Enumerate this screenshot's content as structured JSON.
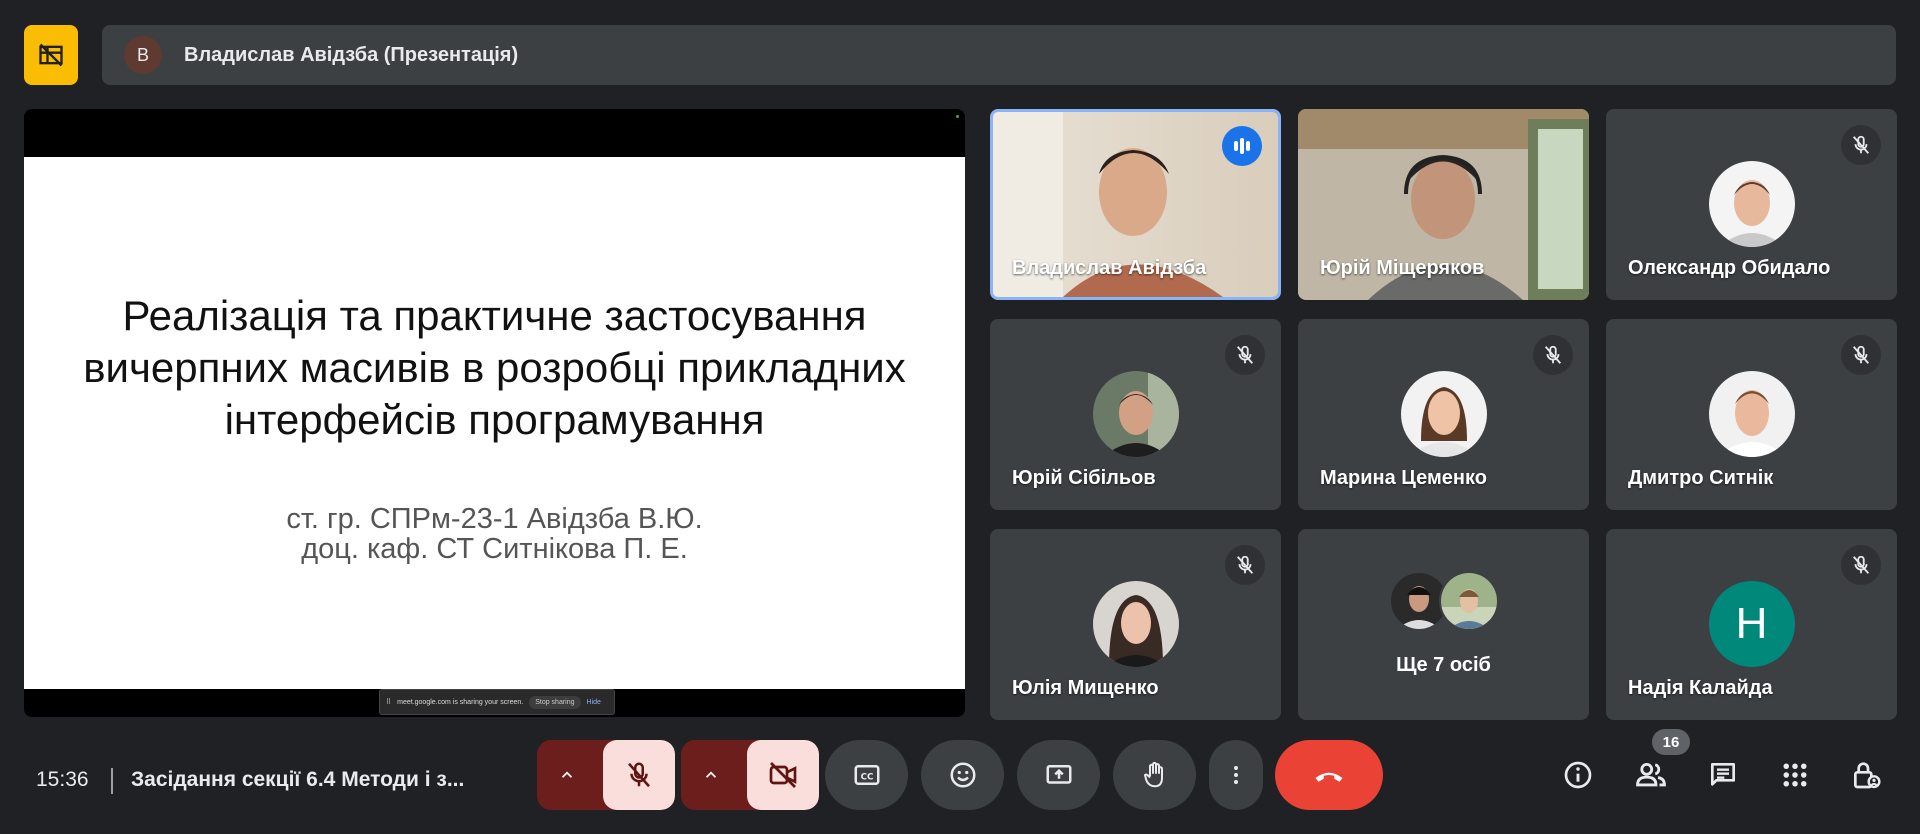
{
  "presenter_bar": {
    "avatar_letter": "В",
    "name": "Владислав Авідзба (Презентація)"
  },
  "slide": {
    "title_lines": [
      "Реалізація та практичне застосування",
      "вичерпних масивів в розробці прикладних",
      "інтерфейсів програмування"
    ],
    "subtitle_lines": [
      "ст. гр. СПРм-23-1 Авідзба В.Ю.",
      "доц. каф. СТ Ситнікова П. Е."
    ],
    "share_text": "meet.google.com is sharing your screen.",
    "stop_label": "Stop sharing",
    "hide_label": "Hide"
  },
  "participants": [
    {
      "name": "Владислав Авідзба",
      "state": "speaking"
    },
    {
      "name": "Юрій Міщеряков",
      "state": "video"
    },
    {
      "name": "Олександр Обидало",
      "state": "muted"
    },
    {
      "name": "Юрій Сібільов",
      "state": "muted"
    },
    {
      "name": "Марина Цеменко",
      "state": "muted"
    },
    {
      "name": "Дмитро Ситнік",
      "state": "muted"
    },
    {
      "name": "Юлія Мищенко",
      "state": "muted"
    },
    {
      "name": "Надія Калайда",
      "state": "muted",
      "initial": "Н",
      "avatar_color": "#00897b"
    }
  ],
  "more_tile": {
    "label": "Ще 7 осіб"
  },
  "bottom_bar": {
    "time": "15:36",
    "meeting_title": "Засідання секції 6.4 Методи і з...",
    "people_count": "16"
  },
  "colors": {
    "background": "#202124",
    "tile": "#3c4043",
    "layout_button": "#fbbc04",
    "leave": "#ea4335",
    "speaking": "#1a73e8"
  },
  "icons": {
    "layout": "grid-off-icon",
    "mic": "mic-off-icon",
    "camera": "videocam-off-icon",
    "captions": "closed-caption-icon",
    "emoji": "emoji-icon",
    "present": "present-screen-icon",
    "hand": "raise-hand-icon",
    "more": "more-vert-icon",
    "leave": "call-end-icon",
    "info": "info-icon",
    "people": "people-icon",
    "chat": "chat-icon",
    "activities": "apps-icon",
    "host": "host-controls-icon"
  }
}
